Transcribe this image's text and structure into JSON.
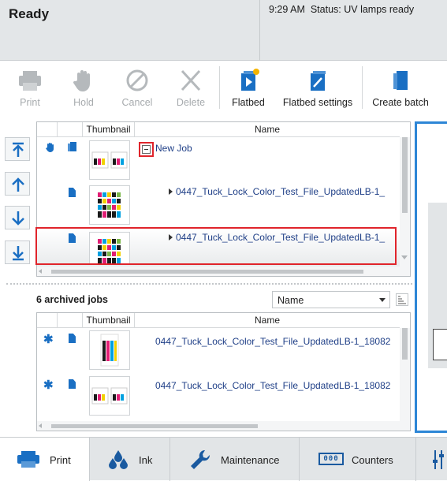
{
  "header": {
    "title": "Ready",
    "time": "9:29 AM",
    "status_label": "Status:",
    "status_value": "UV lamps ready"
  },
  "toolbar": {
    "print": "Print",
    "hold": "Hold",
    "cancel": "Cancel",
    "delete": "Delete",
    "flatbed": "Flatbed",
    "flatbed_settings": "Flatbed settings",
    "create_batch": "Create batch"
  },
  "queue": {
    "col_thumbnail": "Thumbnail",
    "col_name": "Name",
    "group_name": "New Job",
    "rows": [
      {
        "name": "0447_Tuck_Lock_Color_Test_File_UpdatedLB-1_"
      },
      {
        "name": "0447_Tuck_Lock_Color_Test_File_UpdatedLB-1_"
      }
    ]
  },
  "archive": {
    "count_label": "6 archived jobs",
    "sort_value": "Name",
    "col_thumbnail": "Thumbnail",
    "col_name": "Name",
    "rows": [
      {
        "name": "0447_Tuck_Lock_Color_Test_File_UpdatedLB-1_18082"
      },
      {
        "name": "0447_Tuck_Lock_Color_Test_File_UpdatedLB-1_18082"
      }
    ]
  },
  "tabs": {
    "print": "Print",
    "ink": "Ink",
    "maintenance": "Maintenance",
    "counters": "Counters",
    "counters_glyph": "000"
  },
  "colors": {
    "accent": "#1a6fc3",
    "highlight": "#e0242b",
    "job_link": "#1f3f87",
    "disabled": "#a7abae"
  }
}
